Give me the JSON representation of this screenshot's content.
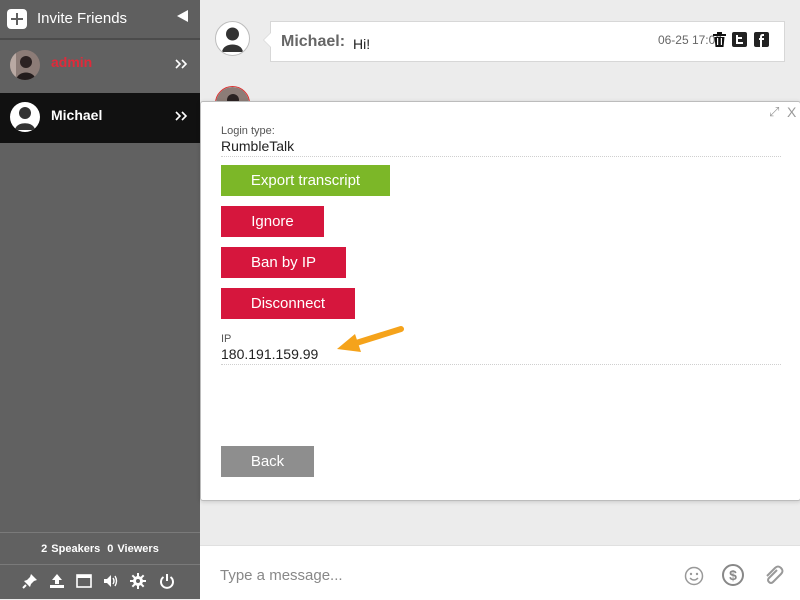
{
  "sidebar": {
    "invite_label": "Invite Friends",
    "users": [
      {
        "name": "admin",
        "active": false
      },
      {
        "name": "Michael",
        "active": true
      }
    ],
    "counts": {
      "speakers_count": "2",
      "speakers_label": "Speakers",
      "viewers_count": "0",
      "viewers_label": "Viewers"
    },
    "toolbar_icons": [
      "pin-icon",
      "upload-icon",
      "window-icon",
      "volume-icon",
      "gear-icon",
      "power-icon"
    ]
  },
  "messages": [
    {
      "author": "Michael:",
      "text": "Hi!",
      "time": "06-25 17:08"
    }
  ],
  "composer": {
    "placeholder": "Type a message..."
  },
  "modal": {
    "login_type_label": "Login type:",
    "login_type_value": "RumbleTalk",
    "buttons": {
      "export": "Export transcript",
      "ignore": "Ignore",
      "ban": "Ban by IP",
      "disconnect": "Disconnect",
      "back": "Back"
    },
    "ip_label": "IP",
    "ip_value": "180.191.159.99",
    "close_label": "X"
  },
  "colors": {
    "sidebar_bg": "#616161",
    "active_user_bg": "#111111",
    "green_button": "#7cb728",
    "red_button": "#d6163d",
    "gray_button": "#8e8e8e",
    "admin_name": "#e02a3a",
    "arrow": "#f5a31b"
  }
}
